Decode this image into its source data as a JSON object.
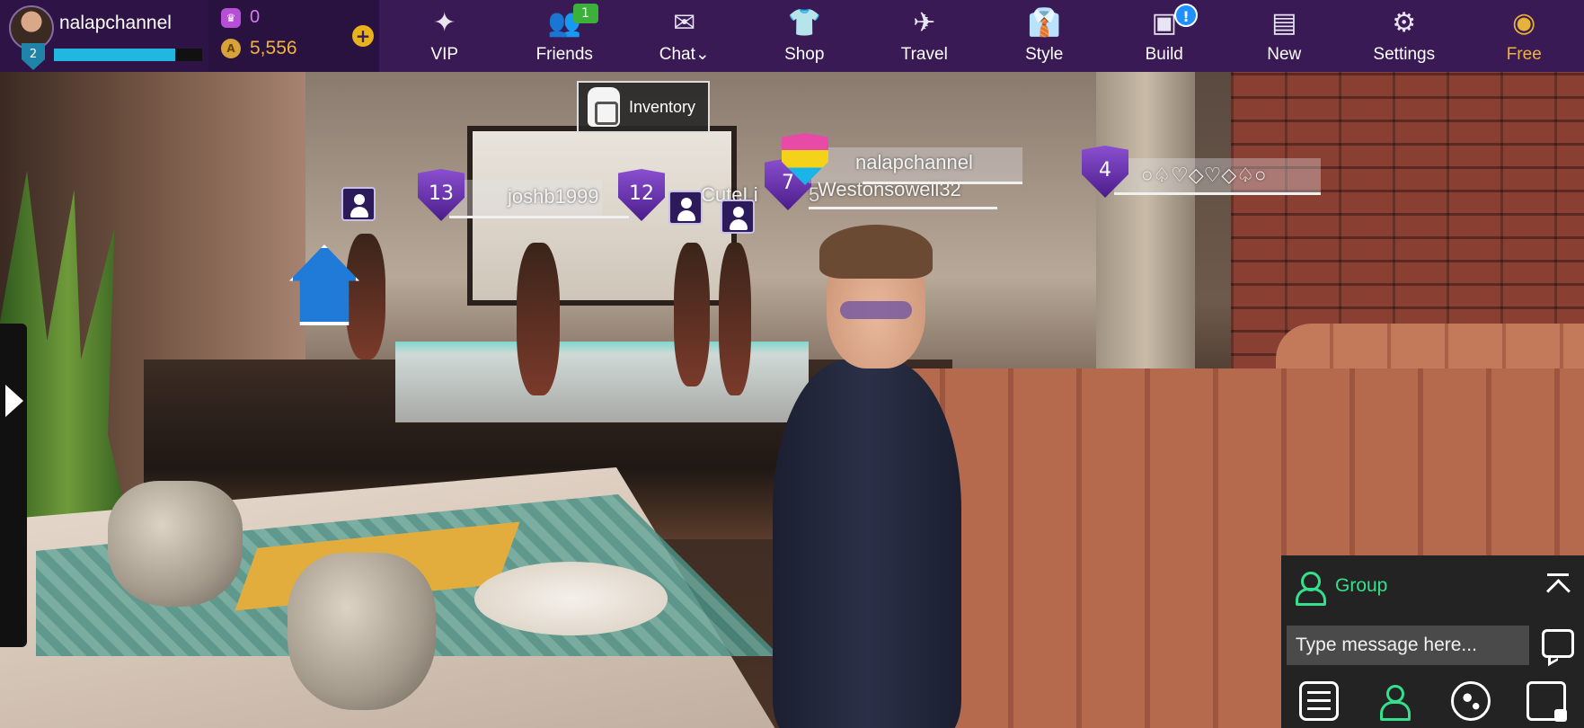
{
  "profile": {
    "username": "nalapchannel",
    "level": "2",
    "xp_fraction": 0.82
  },
  "wallet": {
    "gems": "0",
    "coins": "5,556",
    "add_label": "+"
  },
  "nav": {
    "items": [
      {
        "label": "VIP",
        "icon": "star-icon"
      },
      {
        "label": "Friends",
        "icon": "friends-icon",
        "badge": "1"
      },
      {
        "label": "Chat",
        "icon": "envelope-icon",
        "dropdown": "⌄"
      },
      {
        "label": "Shop",
        "icon": "shirt-icon"
      },
      {
        "label": "Travel",
        "icon": "airplane-icon"
      },
      {
        "label": "Style",
        "icon": "outfit-icon"
      },
      {
        "label": "Build",
        "icon": "box-icon",
        "badge": "!"
      },
      {
        "label": "New",
        "icon": "layout-icon"
      },
      {
        "label": "Settings",
        "icon": "gear-icon"
      },
      {
        "label": "Free",
        "icon": "gold-coins-icon"
      }
    ]
  },
  "inventory": {
    "label": "Inventory"
  },
  "players": [
    {
      "name": "joshb1999",
      "level": "13"
    },
    {
      "name": "CuteLi",
      "level": "12",
      "extra": "5"
    },
    {
      "name": "Westonsowell32",
      "level": "7"
    },
    {
      "name": "nalapchannel"
    },
    {
      "name": "○♤♡◇♡◇♤○",
      "level": "4"
    }
  ],
  "chat": {
    "channel": "Group",
    "placeholder": "Type message here..."
  },
  "colors": {
    "topbar": "#3a1a55",
    "accent_green": "#35e08c",
    "coin_gold": "#f0b43c",
    "gem_purple": "#d77df0",
    "level_shield": "#6a34b0"
  }
}
